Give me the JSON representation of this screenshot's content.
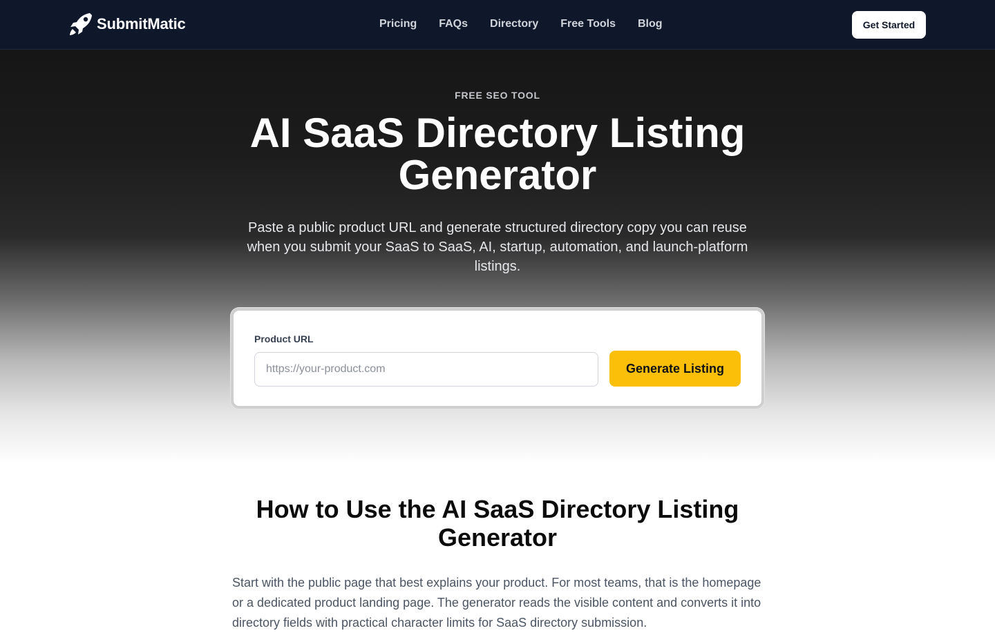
{
  "header": {
    "brand": "SubmitMatic",
    "nav": [
      "Pricing",
      "FAQs",
      "Directory",
      "Free Tools",
      "Blog"
    ],
    "cta_label": "Get Started"
  },
  "hero": {
    "eyebrow": "FREE SEO TOOL",
    "title": "AI SaaS Directory Listing Generator",
    "subtitle": "Paste a public product URL and generate structured directory copy you can reuse when you submit your SaaS to SaaS, AI, startup, automation, and launch-platform listings."
  },
  "form": {
    "label": "Product URL",
    "value": "",
    "placeholder": "https://your-product.com",
    "button_label": "Generate Listing"
  },
  "howto": {
    "title": "How to Use the AI SaaS Directory Listing Generator",
    "body": "Start with the public page that best explains your product. For most teams, that is the homepage or a dedicated product landing page. The generator reads the visible content and converts it into directory fields with practical character limits for SaaS directory submission."
  },
  "colors": {
    "header_bg": "#0f172a",
    "accent_button": "#fbbf0a"
  }
}
